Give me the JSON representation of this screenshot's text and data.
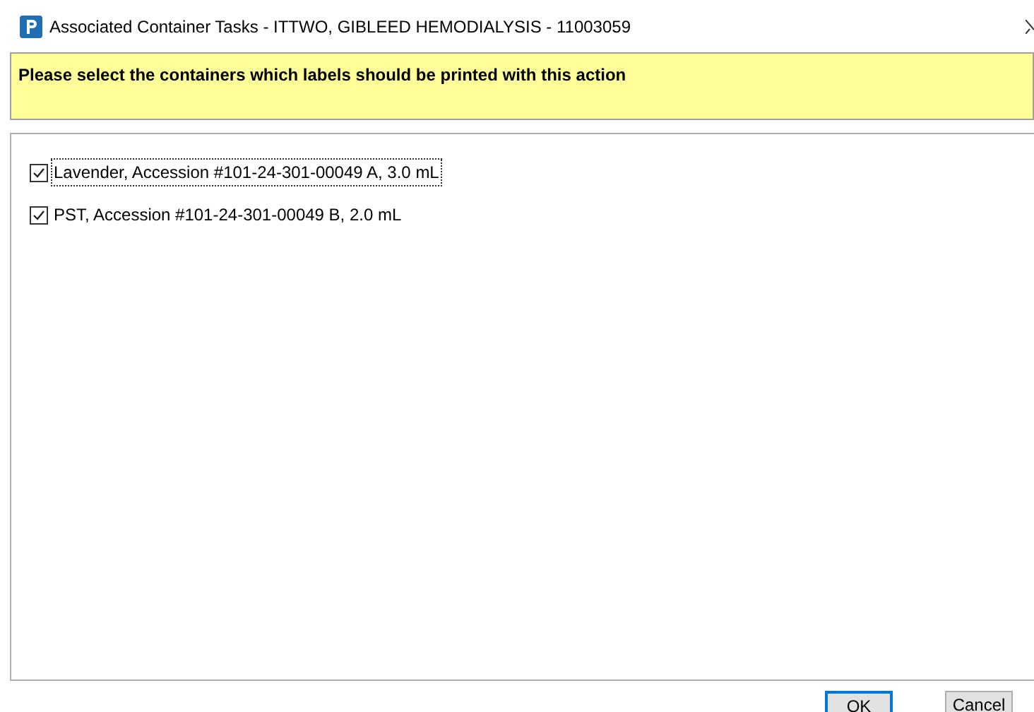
{
  "window": {
    "title": "Associated Container Tasks - ITTWO, GIBLEED HEMODIALYSIS - 11003059"
  },
  "instruction": "Please select the containers which labels should be printed with this action",
  "containers": [
    {
      "label": "Lavender, Accession #101-24-301-00049 A, 3.0 mL",
      "checked": true,
      "focused": true
    },
    {
      "label": "PST, Accession #101-24-301-00049 B, 2.0 mL",
      "checked": true,
      "focused": false
    }
  ],
  "buttons": [
    {
      "label": "OK",
      "kind": "default"
    },
    {
      "label": "Cancel",
      "kind": "normal"
    }
  ]
}
